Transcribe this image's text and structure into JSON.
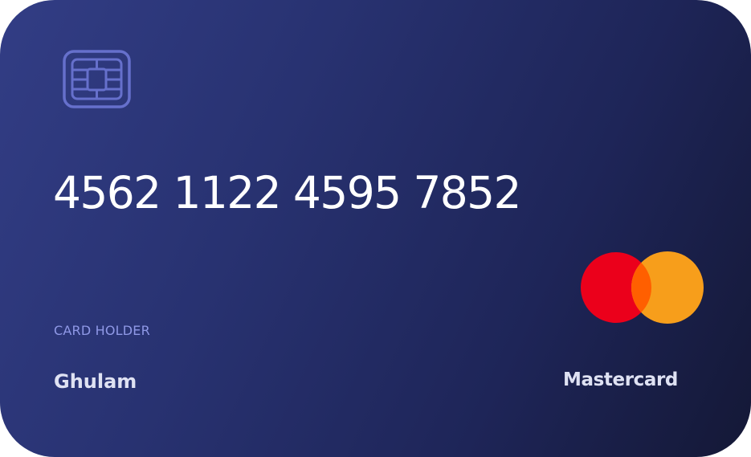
{
  "card": {
    "number": "4562 1122 4595 7852",
    "holder_label": "CARD HOLDER",
    "holder_name": "Ghulam",
    "brand": "Mastercard"
  },
  "colors": {
    "card_gradient_start": "#323d85",
    "card_gradient_end": "#141836",
    "mastercard_red": "#eb001b",
    "mastercard_orange": "#f79e1b",
    "mastercard_overlap": "#ff5f00",
    "label_color": "#8f98e6"
  },
  "icons": {
    "chip": "chip-icon",
    "brand_logo": "mastercard-logo-icon"
  }
}
